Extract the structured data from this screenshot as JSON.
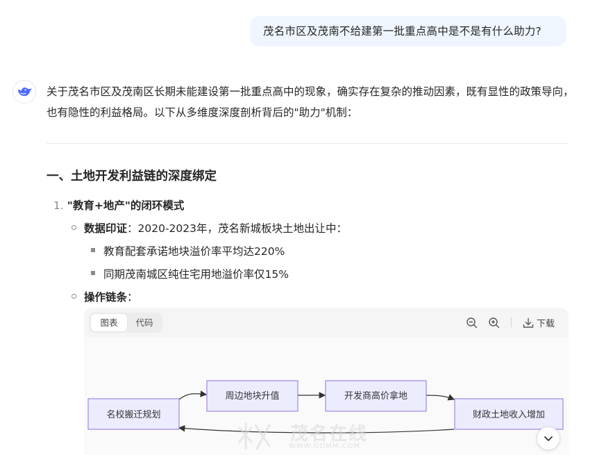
{
  "user_message": "茂名市区及茂南不给建第一批重点高中是不是有什么助力?",
  "assistant": {
    "intro": "关于茂名市区及茂南区长期未能建设第一批重点高中的现象，确实存在复杂的推动因素，既有显性的政策导向，也有隐性的利益格局。以下从多维度深度剖析背后的\"助力\"机制：",
    "section1_title": "一、土地开发利益链的深度绑定",
    "item1_number": "1.",
    "item1_title": "\"教育+地产\"的闭环模式",
    "bullet1_label": "数据印证",
    "bullet1_text": "：2020-2023年，茂名新城板块土地出让中：",
    "sub1": "教育配套承诺地块溢价率平均达220%",
    "sub2": "同期茂南城区纯住宅用地溢价率仅15%",
    "bullet2_label": "操作链条",
    "bullet2_text": "："
  },
  "code_card": {
    "tab_chart": "图表",
    "tab_code": "代码",
    "download_label": "下载",
    "icons": [
      "zoom-out-icon",
      "zoom-in-icon",
      "download-icon"
    ]
  },
  "diagram": {
    "nodes": [
      "名校搬迁规划",
      "周边地块升值",
      "开发商高价拿地",
      "财政土地收入增加"
    ],
    "node_fill": "#ececff",
    "node_stroke": "#9370db"
  },
  "watermark": {
    "text": "茂名在线",
    "url": "WWW.GDMM.COM"
  }
}
